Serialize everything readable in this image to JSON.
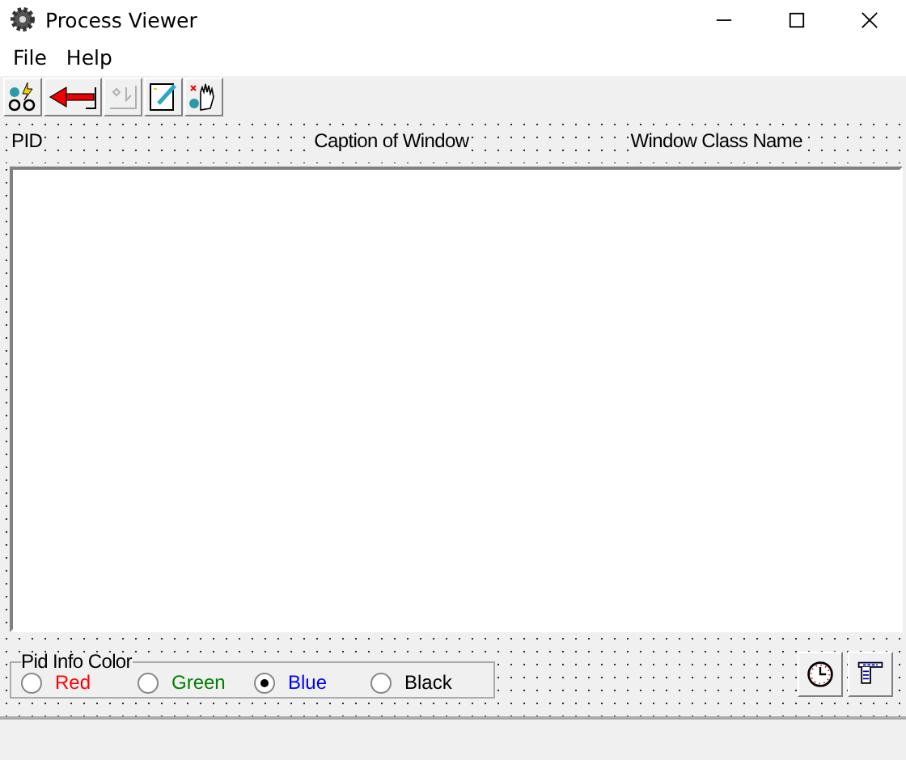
{
  "window": {
    "title": "Process Viewer"
  },
  "menu": [
    "File",
    "Help"
  ],
  "toolbar": [
    {
      "kind": "viewer",
      "disabled": false
    },
    {
      "kind": "back",
      "disabled": false
    },
    {
      "kind": "blank",
      "disabled": true
    },
    {
      "kind": "edit",
      "disabled": false
    },
    {
      "kind": "stop",
      "disabled": false
    }
  ],
  "columns": [
    "PID",
    "Caption of Window",
    "Window Class Name"
  ],
  "color_group": {
    "title": "Pid Info Color",
    "options": [
      {
        "label": "Red",
        "color": "#ff0000",
        "selected": false
      },
      {
        "label": "Green",
        "color": "#008000",
        "selected": false
      },
      {
        "label": "Blue",
        "color": "#0000ff",
        "selected": true
      },
      {
        "label": "Black",
        "color": "#000000",
        "selected": false
      }
    ]
  },
  "bottom_buttons": [
    {
      "kind": "clock"
    },
    {
      "kind": "list"
    }
  ]
}
